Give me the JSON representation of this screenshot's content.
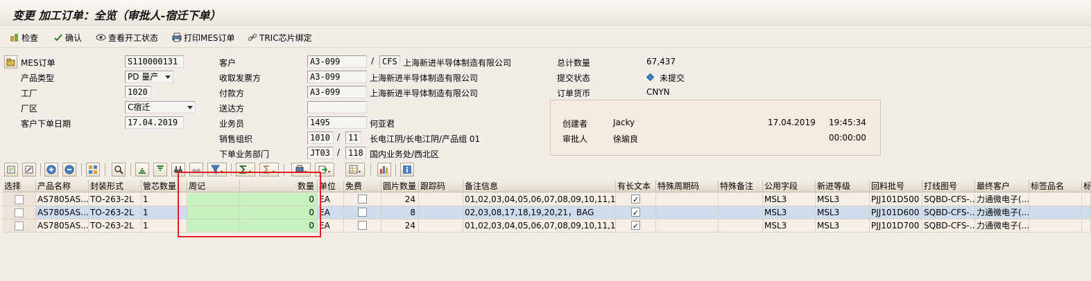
{
  "window": {
    "title": "变更 加工订单：全览（审批人-宿迁下单）"
  },
  "toolbar": {
    "check": "检查",
    "confirm": "确认",
    "view_status": "查看开工状态",
    "print_mes": "打印MES订单",
    "tric_bind": "TRIC芯片绑定"
  },
  "header": {
    "mes_order_label": "MES订单",
    "mes_order_value": "S110000131",
    "product_type_label": "产品类型",
    "product_type_value": "PD 量产",
    "plant_label": "工厂",
    "plant_value": "1020",
    "area_label": "厂区",
    "area_value": "C宿迁",
    "order_date_label": "客户下单日期",
    "order_date_value": "17.04.2019",
    "customer_label": "客户",
    "customer_code": "A3-099",
    "customer_short": "CFS",
    "customer_name": "上海新进半导体制造有限公司",
    "invoice_label": "收取发票方",
    "invoice_code": "A3-099",
    "invoice_name": "上海新进半导体制造有限公司",
    "payer_label": "付款方",
    "payer_code": "A3-099",
    "payer_name": "上海新进半导体制造有限公司",
    "ship_label": "送达方",
    "ship_code": "",
    "sales_rep_label": "业务员",
    "sales_rep_code": "1495",
    "sales_rep_name": "何亚君",
    "sales_org_label": "销售组织",
    "sales_org_code": "1010",
    "sales_org_div": "11",
    "sales_org_text": "长电江阴/长电江阴/产品组 01",
    "dept_label": "下单业务部门",
    "dept_code": "JT03",
    "dept_num": "118",
    "dept_text": "国内业务处/西北区",
    "slash": "/",
    "total_qty_label": "总计数量",
    "total_qty_value": "67,437",
    "submit_label": "提交状态",
    "submit_value": "未提交",
    "currency_label": "订单货币",
    "currency_value": "CNYN"
  },
  "infobox": {
    "creator_label": "创建者",
    "creator_value": "Jacky",
    "create_date": "17.04.2019",
    "create_time": "19:45:34",
    "approver_label": "审批人",
    "approver_value": "徐瑜良",
    "approve_time": "00:00:00"
  },
  "grid": {
    "columns": [
      "选择",
      "产品名称",
      "封装形式",
      "管芯数量",
      "周记",
      "数量",
      "单位",
      "免费",
      "圆片数量",
      "跟踪码",
      "备注信息",
      "有长文本",
      "特殊周期码",
      "特殊备注",
      "公用字段",
      "新进等级",
      "回料批号",
      "打线图号",
      "最终客户",
      "标签品名",
      "标"
    ],
    "rows": [
      {
        "product": "AS7805AS...",
        "package": "TO-263-2L",
        "die": "1",
        "week": "",
        "qty": "0",
        "unit": "EA",
        "wafer": "24",
        "trace": "",
        "remark": "01,02,03,04,05,06,07,08,09,10,11,1...",
        "public": "MSL3",
        "grade": "MSL3",
        "lot": "PJJ101D500",
        "wire": "SQBD-CFS-...",
        "customer": "力通微电子(..."
      },
      {
        "product": "AS7805AS...",
        "package": "TO-263-2L",
        "die": "1",
        "week": "",
        "qty": "0",
        "unit": "EA",
        "wafer": "8",
        "trace": "",
        "remark": "02,03,08,17,18,19,20,21，BAG",
        "public": "MSL3",
        "grade": "MSL3",
        "lot": "PJJ101D600",
        "wire": "SQBD-CFS-...",
        "customer": "力通微电子(..."
      },
      {
        "product": "AS7805AS...",
        "package": "TO-263-2L",
        "die": "1",
        "week": "",
        "qty": "0",
        "unit": "EA",
        "wafer": "24",
        "trace": "",
        "remark": "01,02,03,04,05,06,07,08,09,10,11,1...",
        "public": "MSL3",
        "grade": "MSL3",
        "lot": "PJJ101D700",
        "wire": "SQBD-CFS-...",
        "customer": "力通微电子(..."
      }
    ]
  },
  "colors": {
    "highlight_row": "#cfdcee",
    "row_bg": "#f6efe8",
    "green_input": "#c6f2c0",
    "red_box": "#e02020"
  }
}
